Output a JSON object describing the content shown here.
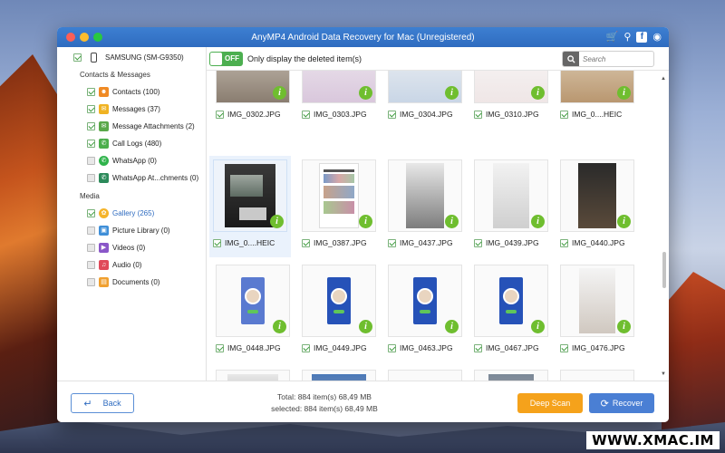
{
  "window": {
    "title": "AnyMP4 Android Data Recovery for Mac (Unregistered)"
  },
  "device": {
    "name": "SAMSUNG (SM-G9350)"
  },
  "sidebar": {
    "contacts_heading": "Contacts & Messages",
    "contacts_items": [
      {
        "label": "Contacts (100)",
        "checked": true
      },
      {
        "label": "Messages (37)",
        "checked": true
      },
      {
        "label": "Message Attachments (2)",
        "checked": true
      },
      {
        "label": "Call Logs (480)",
        "checked": true
      },
      {
        "label": "WhatsApp (0)",
        "checked": false
      },
      {
        "label": "WhatsApp At...chments (0)",
        "checked": false
      }
    ],
    "media_heading": "Media",
    "media_items": [
      {
        "label": "Gallery (265)",
        "checked": true,
        "selected": true
      },
      {
        "label": "Picture Library (0)",
        "checked": false
      },
      {
        "label": "Videos (0)",
        "checked": false
      },
      {
        "label": "Audio (0)",
        "checked": false
      },
      {
        "label": "Documents (0)",
        "checked": false
      }
    ]
  },
  "toolbar": {
    "toggle_label": "OFF",
    "filter_label": "Only display the deleted item(s)",
    "search_placeholder": "Search"
  },
  "grid": {
    "row1": [
      "IMG_0302.JPG",
      "IMG_0303.JPG",
      "IMG_0304.JPG",
      "IMG_0310.JPG",
      "IMG_0....HEIC"
    ],
    "row2": [
      "IMG_0....HEIC",
      "IMG_0387.JPG",
      "IMG_0437.JPG",
      "IMG_0439.JPG",
      "IMG_0440.JPG"
    ],
    "row3": [
      "IMG_0448.JPG",
      "IMG_0449.JPG",
      "IMG_0463.JPG",
      "IMG_0467.JPG",
      "IMG_0476.JPG"
    ],
    "info_glyph": "i"
  },
  "footer": {
    "back_label": "Back",
    "total_text": "Total: 884 item(s) 68,49 MB",
    "selected_text": "selected: 884 item(s) 68,49 MB",
    "deep_scan_label": "Deep Scan",
    "recover_label": "Recover"
  },
  "watermark": "WWW.XMAC.IM",
  "colors": {
    "titlebar": "#2f6cc0",
    "toggle_green": "#4caf50",
    "deep_scan": "#f5a21b",
    "recover": "#4a7fd4",
    "info_badge": "#6fbe2f"
  }
}
